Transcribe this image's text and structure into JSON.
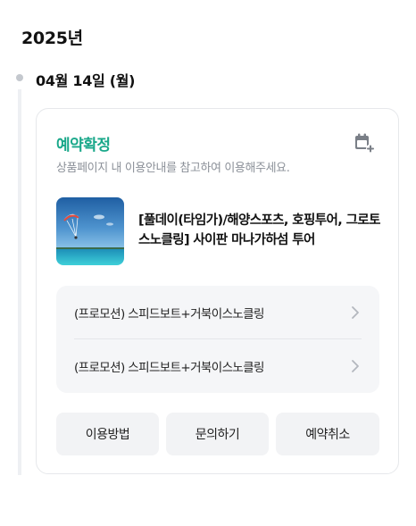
{
  "header": {
    "year": "2025년"
  },
  "timeline": {
    "date": "04월 14일 (월)"
  },
  "reservation": {
    "status": "예약확정",
    "notice": "상품페이지 내 이용안내를 참고하여 이용해주세요.",
    "calendar_icon": "calendar-add-icon",
    "product": {
      "title": "[풀데이(타임가)/해양스포츠, 호핑투어, 그로토 스노클링] 사이판 마나가하섬 투어"
    },
    "options": [
      {
        "label": "(프로모션) 스피드보트+거북이스노클링"
      },
      {
        "label": "(프로모션) 스피드보트+거북이스노클링"
      }
    ],
    "actions": {
      "how_to_use": "이용방법",
      "inquiry": "문의하기",
      "cancel": "예약취소"
    }
  },
  "colors": {
    "status_green": "#1aa88a",
    "muted_text": "#8b9098",
    "panel_bg": "#f5f6f8",
    "button_bg": "#f2f3f5"
  }
}
